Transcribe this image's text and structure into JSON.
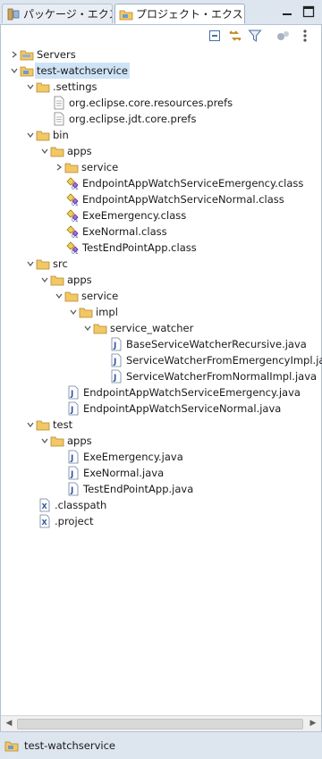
{
  "tabs": [
    {
      "label": "パッケージ・エクスプロ",
      "active": false
    },
    {
      "label": "プロジェクト・エクスプ",
      "active": true
    }
  ],
  "window_controls": [
    "minimize-icon",
    "maximize-icon"
  ],
  "toolbar": [
    "collapse-all-icon",
    "link-with-editor-icon",
    "filter-icon",
    "focus-icon",
    "view-menu-icon"
  ],
  "tree": [
    {
      "label": "Servers",
      "icon": "folder-icon",
      "expanded": false
    },
    {
      "label": "test-watchservice",
      "icon": "project-icon",
      "expanded": true,
      "selected": true
    },
    {
      "label": ".settings",
      "icon": "folder-icon",
      "expanded": true
    },
    {
      "label": "org.eclipse.core.resources.prefs",
      "icon": "text-file-icon"
    },
    {
      "label": "org.eclipse.jdt.core.prefs",
      "icon": "text-file-icon"
    },
    {
      "label": "bin",
      "icon": "folder-icon",
      "expanded": true
    },
    {
      "label": "apps",
      "icon": "folder-icon",
      "expanded": true
    },
    {
      "label": "service",
      "icon": "folder-icon",
      "expanded": false
    },
    {
      "label": "EndpointAppWatchServiceEmergency.class",
      "icon": "class-file-icon"
    },
    {
      "label": "EndpointAppWatchServiceNormal.class",
      "icon": "class-file-icon"
    },
    {
      "label": "ExeEmergency.class",
      "icon": "class-file-icon"
    },
    {
      "label": "ExeNormal.class",
      "icon": "class-file-icon"
    },
    {
      "label": "TestEndPointApp.class",
      "icon": "class-file-icon"
    },
    {
      "label": "src",
      "icon": "folder-icon",
      "expanded": true
    },
    {
      "label": "apps",
      "icon": "folder-icon",
      "expanded": true
    },
    {
      "label": "service",
      "icon": "folder-icon",
      "expanded": true
    },
    {
      "label": "impl",
      "icon": "folder-icon",
      "expanded": true
    },
    {
      "label": "service_watcher",
      "icon": "folder-icon",
      "expanded": true
    },
    {
      "label": "BaseServiceWatcherRecursive.java",
      "icon": "java-file-icon"
    },
    {
      "label": "ServiceWatcherFromEmergencyImpl.java",
      "icon": "java-file-icon"
    },
    {
      "label": "ServiceWatcherFromNormalImpl.java",
      "icon": "java-file-icon"
    },
    {
      "label": "EndpointAppWatchServiceEmergency.java",
      "icon": "java-file-icon"
    },
    {
      "label": "EndpointAppWatchServiceNormal.java",
      "icon": "java-file-icon"
    },
    {
      "label": "test",
      "icon": "folder-icon",
      "expanded": true
    },
    {
      "label": "apps",
      "icon": "folder-icon",
      "expanded": true
    },
    {
      "label": "ExeEmergency.java",
      "icon": "java-file-icon"
    },
    {
      "label": "ExeNormal.java",
      "icon": "java-file-icon"
    },
    {
      "label": "TestEndPointApp.java",
      "icon": "java-file-icon"
    },
    {
      "label": ".classpath",
      "icon": "xml-file-icon"
    },
    {
      "label": ".project",
      "icon": "xml-file-icon"
    }
  ],
  "status": {
    "label": "test-watchservice",
    "icon": "project-icon"
  },
  "colors": {
    "tabbar": "#dde5ef",
    "selection": "#cfe3f7",
    "folder": "#f2c766",
    "java": "#2f55a4"
  }
}
